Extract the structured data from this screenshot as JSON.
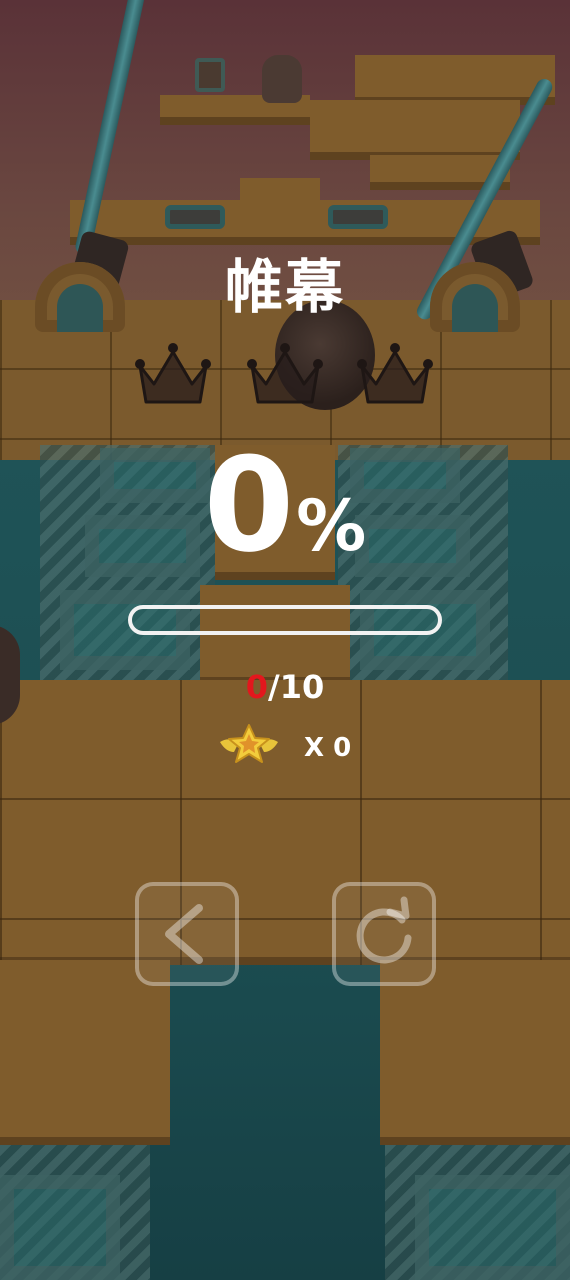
{
  "level": {
    "name": "帷幕"
  },
  "crowns": {
    "total": 3,
    "earned": 0,
    "icon": "crown-icon"
  },
  "progress": {
    "percent_value": "0",
    "percent_sign": "%",
    "fraction": 0
  },
  "collectibles": {
    "current": "0",
    "total": "/10",
    "current_color": "#e3171d"
  },
  "stars": {
    "icon": "winged-star-icon",
    "count_label": "X 0"
  },
  "controls": {
    "back_icon": "back-arrow-icon",
    "restart_icon": "restart-icon"
  }
}
